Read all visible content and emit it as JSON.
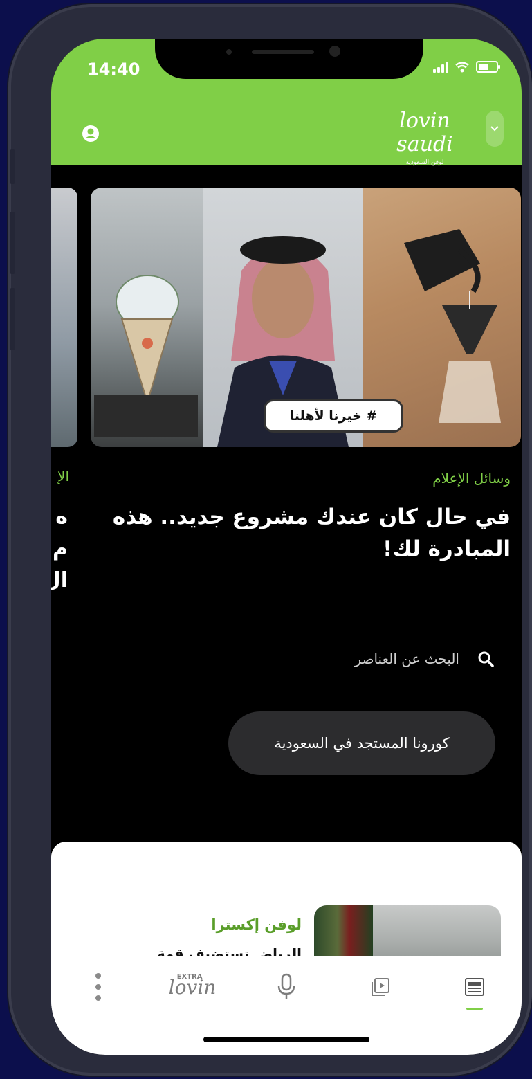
{
  "status_bar": {
    "time": "14:40"
  },
  "header": {
    "brand_name": "lovin saudi",
    "brand_sub": "لوفن السعودية"
  },
  "hero": {
    "hashtag": "# خيرنا لأهلنا",
    "category": "وسائل الإعلام",
    "headline": "في حال كان عندك مشروع جديد.. هذه المبادرة لك!"
  },
  "peek_card": {
    "category": "الإ",
    "headline": "ه م ال"
  },
  "search": {
    "placeholder": "البحث عن العناصر"
  },
  "topic_chip": {
    "label": "كورونا المستجد في السعودية"
  },
  "extra_section": {
    "label": "لوفن إكسترا",
    "teaser": "الرياض تستضيف قمة"
  },
  "bottom_nav": {
    "items": [
      {
        "name": "more",
        "icon": "more-vertical-icon"
      },
      {
        "name": "extra",
        "label_top": "EXTRA",
        "label": "lovin"
      },
      {
        "name": "podcast",
        "icon": "microphone-icon"
      },
      {
        "name": "videos",
        "icon": "video-icon"
      },
      {
        "name": "news",
        "icon": "news-icon",
        "active": true
      }
    ]
  },
  "colors": {
    "brand_green": "#80cf47",
    "background": "#0c0f4c"
  }
}
